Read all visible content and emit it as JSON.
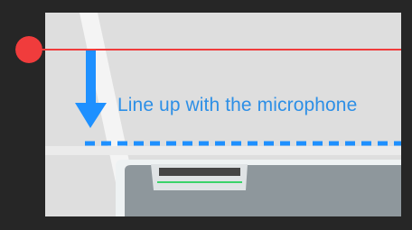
{
  "overlay": {
    "instruction_text": "Line up with the microphone"
  },
  "colors": {
    "accent_blue": "#1e90ff",
    "text_blue": "#2d8fe6",
    "marker_red": "#f03c3c",
    "mic_slot_green": "#39d36a",
    "panel_bg": "#dedede",
    "frame_bg": "#262626"
  },
  "icons": {
    "marker": "red-circle-marker",
    "arrow": "down-arrow"
  }
}
